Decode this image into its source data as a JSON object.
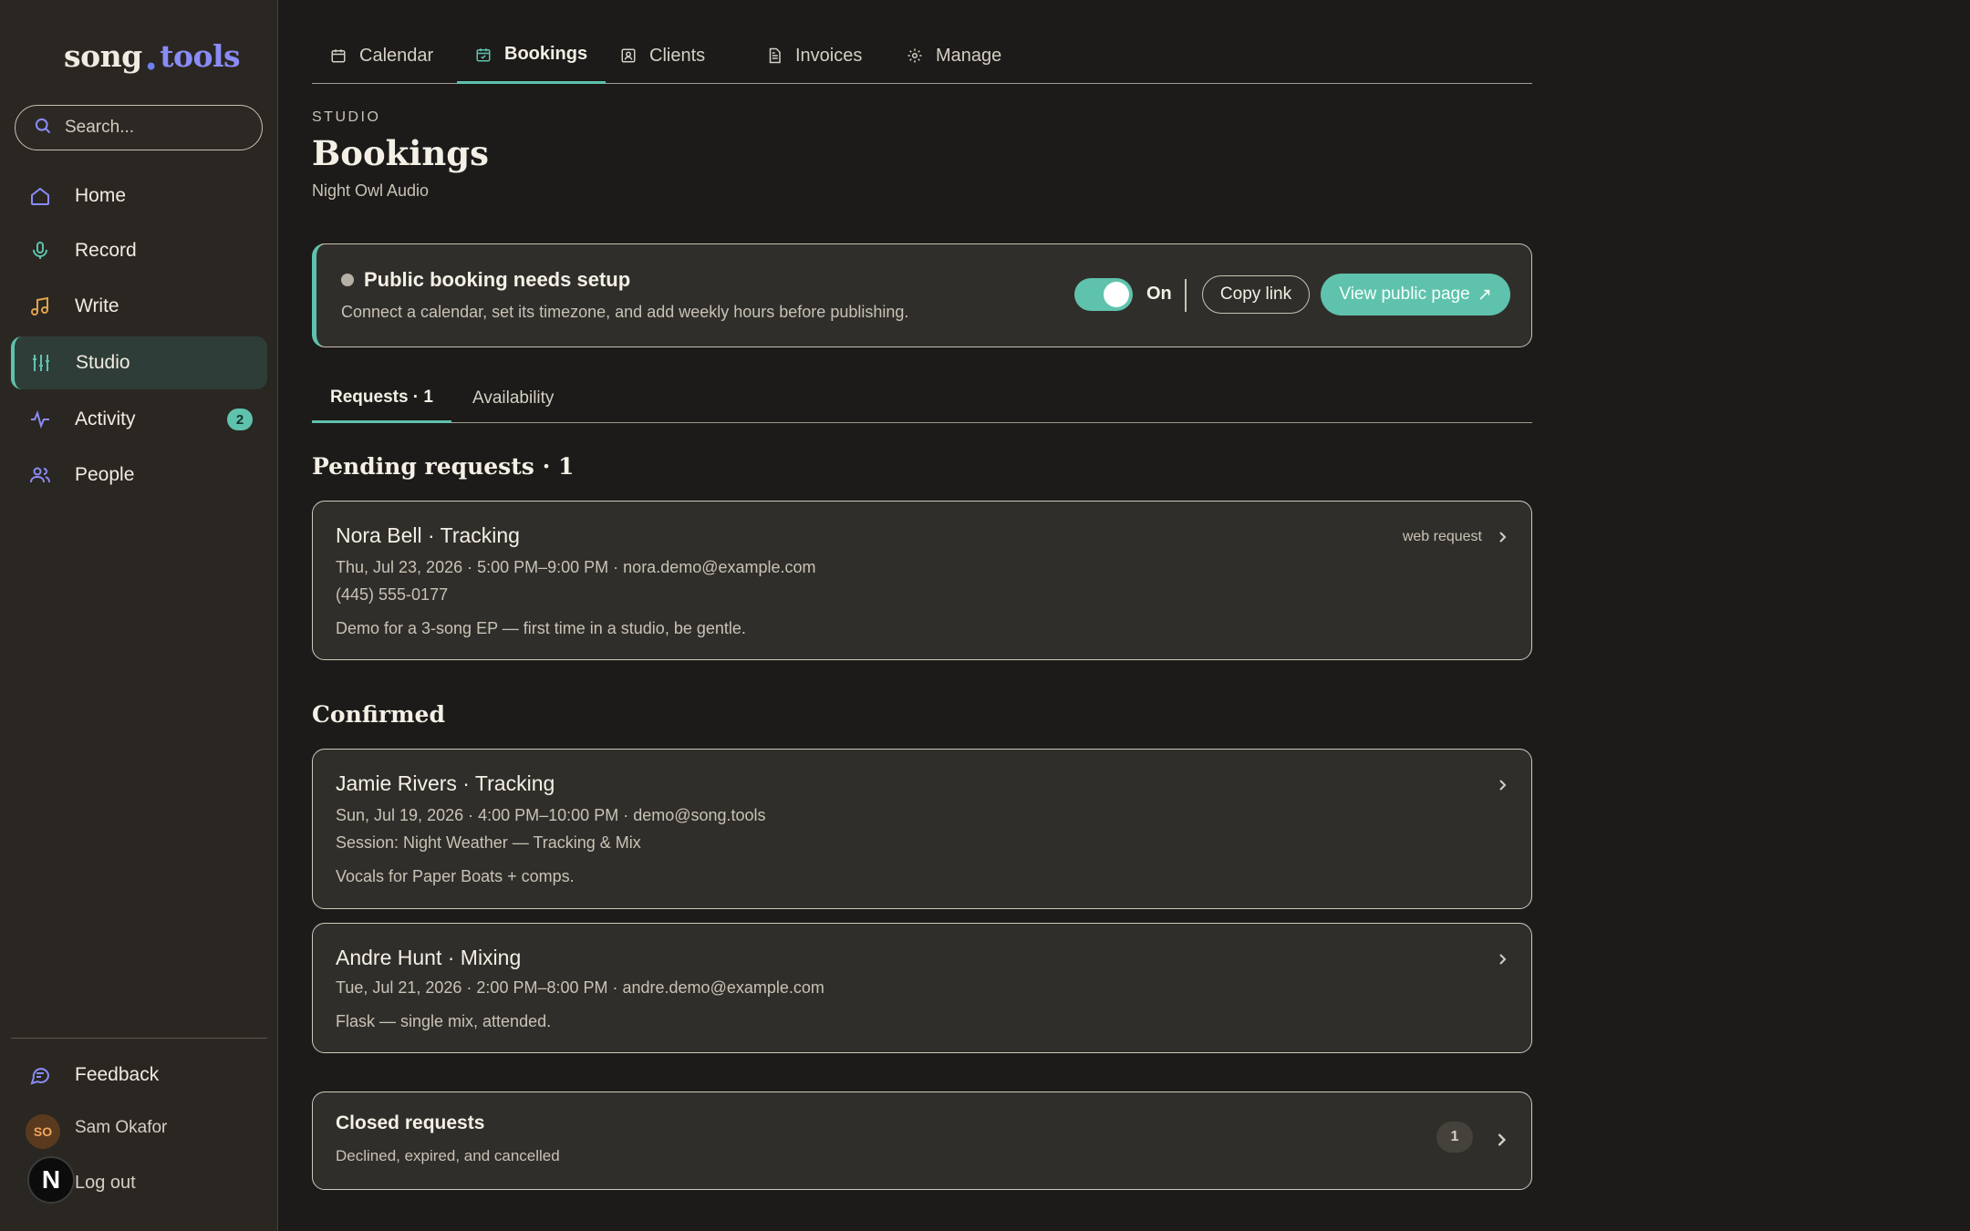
{
  "app": {
    "logo_left": "song",
    "logo_dot": "•",
    "logo_right": "tools"
  },
  "search": {
    "placeholder": "Search..."
  },
  "sidebar": {
    "items": [
      {
        "label": "Home",
        "icon": "home-icon"
      },
      {
        "label": "Record",
        "icon": "microphone-icon"
      },
      {
        "label": "Write",
        "icon": "music-note-icon"
      },
      {
        "label": "Studio",
        "icon": "sliders-icon",
        "active": true
      },
      {
        "label": "Activity",
        "icon": "activity-icon",
        "badge": "2"
      },
      {
        "label": "People",
        "icon": "people-icon"
      }
    ],
    "feedback": "Feedback",
    "user": {
      "initials": "SO",
      "name": "Sam Okafor"
    },
    "logout": "Log out",
    "floating_badge": "N"
  },
  "tabs": [
    {
      "label": "Calendar",
      "icon": "calendar-icon"
    },
    {
      "label": "Bookings",
      "icon": "calendar-check-icon",
      "active": true
    },
    {
      "label": "Clients",
      "icon": "contact-icon"
    },
    {
      "label": "Invoices",
      "icon": "document-icon"
    },
    {
      "label": "Manage",
      "icon": "gear-icon"
    }
  ],
  "page": {
    "eyebrow": "STUDIO",
    "title": "Bookings",
    "subtitle": "Night Owl Audio"
  },
  "setup": {
    "title": "Public booking needs setup",
    "description": "Connect a calendar, set its timezone, and add weekly hours before publishing.",
    "toggle_label": "On",
    "copy_label": "Copy link",
    "view_label": "View public page",
    "view_icon": "↗"
  },
  "subtabs": [
    {
      "label": "Requests · 1",
      "active": true
    },
    {
      "label": "Availability"
    }
  ],
  "pending": {
    "heading": "Pending requests · 1",
    "items": [
      {
        "title": "Nora Bell · Tracking",
        "line1": "Thu, Jul 23, 2026 · 5:00 PM–9:00 PM · nora.demo@example.com",
        "line2": "(445) 555-0177",
        "note": "Demo for a 3-song EP — first time in a studio, be gentle.",
        "tag": "web request"
      }
    ]
  },
  "confirmed": {
    "heading": "Confirmed",
    "items": [
      {
        "title": "Jamie Rivers · Tracking",
        "line1": "Sun, Jul 19, 2026 · 4:00 PM–10:00 PM · demo@song.tools",
        "line2": "Session: Night Weather — Tracking & Mix",
        "note": "Vocals for Paper Boats + comps."
      },
      {
        "title": "Andre Hunt · Mixing",
        "line1": "Tue, Jul 21, 2026 · 2:00 PM–8:00 PM · andre.demo@example.com",
        "note": "Flask — single mix, attended."
      }
    ]
  },
  "closed": {
    "title": "Closed requests",
    "subtitle": "Declined, expired, and cancelled",
    "count": "1"
  },
  "colors": {
    "accent": "#5fc2ad",
    "background": "#1c1b19",
    "sidebar": "#2a2723",
    "card": "#302e2a"
  }
}
